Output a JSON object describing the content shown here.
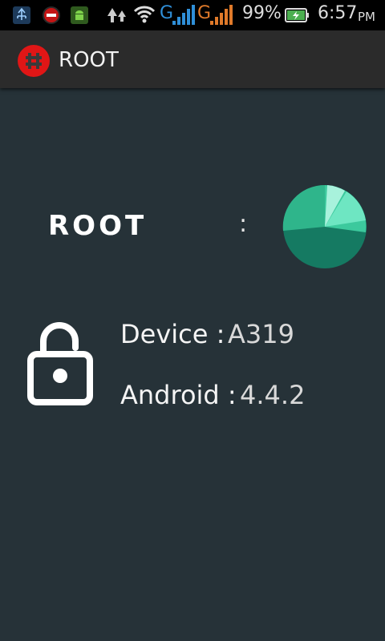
{
  "status_bar": {
    "battery": "99%",
    "time": "6:57",
    "ampm": "PM",
    "net1": "G",
    "net2": "G",
    "icons": [
      "usb-icon",
      "notification-icon",
      "android-icon",
      "trees-icon",
      "wifi-icon",
      "signal-icon",
      "signal-icon",
      "battery-charging-icon"
    ]
  },
  "app_bar": {
    "title": "ROOT",
    "icon": "hash-app-icon",
    "icon_color": "#e01616"
  },
  "main": {
    "logo_text": "ROOT",
    "separator": ":",
    "status_icon": "teal-radial-indicator",
    "lock_icon": "unlock-icon",
    "device_label": "Device :",
    "device_value": "A319",
    "android_label": "Android :",
    "android_value": "4.4.2"
  },
  "colors": {
    "background": "#263238",
    "accent": "#1a7a64"
  }
}
